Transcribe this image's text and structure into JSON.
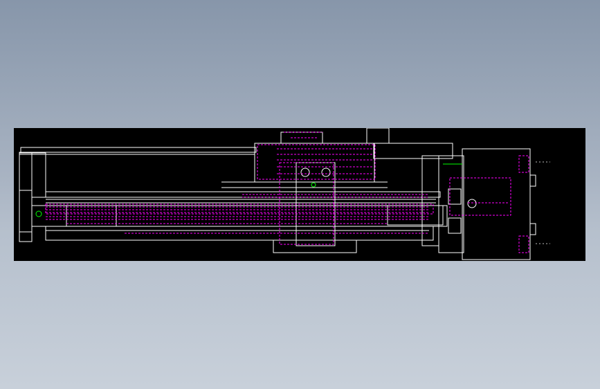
{
  "viewer": {
    "background": "#8f9db0",
    "viewport_background": "#000000"
  },
  "drawing": {
    "colors": {
      "outline": "#ffffff",
      "hidden_lines": "#ff00ff",
      "centerline": "#00ff00",
      "dim": "#c0c0c0"
    },
    "icons": [
      "linear-actuator-drawing"
    ]
  }
}
